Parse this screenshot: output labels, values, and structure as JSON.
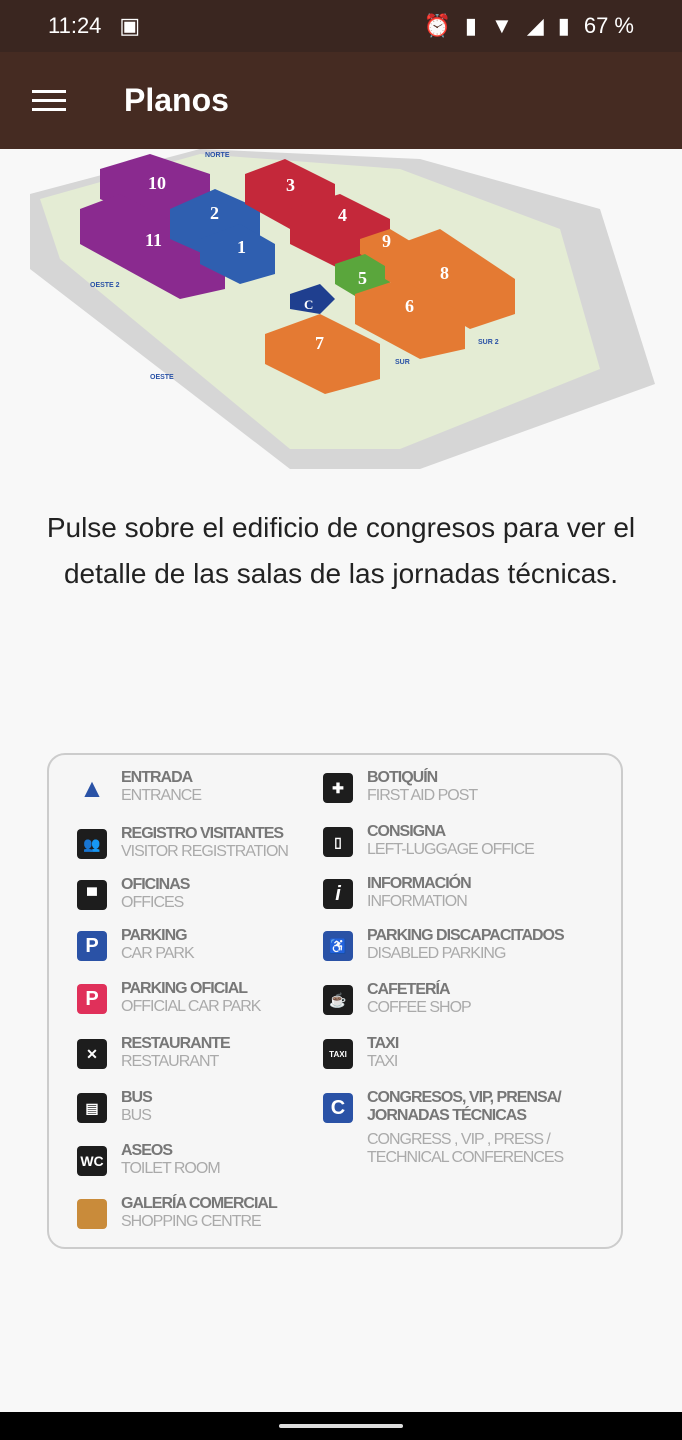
{
  "status": {
    "time": "11:24",
    "battery": "67 %"
  },
  "appbar": {
    "title": "Planos"
  },
  "map": {
    "buildings": [
      "1",
      "2",
      "3",
      "4",
      "5",
      "6",
      "7",
      "8",
      "9",
      "10",
      "11",
      "C"
    ],
    "gates": [
      "NORTE",
      "OESTE 2",
      "OESTE",
      "SUR",
      "SUR 2"
    ]
  },
  "instructions": "Pulse sobre el edificio de congresos para ver el detalle de las salas de las jornadas técnicas.",
  "legend": {
    "left": [
      {
        "es": "ENTRADA",
        "en": "ENTRANCE",
        "icon": "triangle-icon"
      },
      {
        "es": "REGISTRO VISITANTES",
        "en": "VISITOR REGISTRATION",
        "icon": "people-icon"
      },
      {
        "es": "OFICINAS",
        "en": "OFFICES",
        "icon": "desk-icon"
      },
      {
        "es": "PARKING",
        "en": "CAR PARK",
        "icon": "P"
      },
      {
        "es": "PARKING OFICIAL",
        "en": "OFFICIAL CAR PARK",
        "icon": "P"
      },
      {
        "es": "RESTAURANTE",
        "en": "RESTAURANT",
        "icon": "✕"
      },
      {
        "es": "BUS",
        "en": "BUS",
        "icon": "bus-icon"
      },
      {
        "es": "ASEOS",
        "en": "TOILET ROOM",
        "icon": "WC"
      },
      {
        "es": "GALERÍA COMERCIAL",
        "en": "SHOPPING CENTRE",
        "icon": "square"
      }
    ],
    "right": [
      {
        "es": "BOTIQUÍN",
        "en": "FIRST AID POST",
        "icon": "✚"
      },
      {
        "es": "CONSIGNA",
        "en": "LEFT-LUGGAGE OFFICE",
        "icon": "🔒"
      },
      {
        "es": "INFORMACIÓN",
        "en": "INFORMATION",
        "icon": "i"
      },
      {
        "es": "PARKING DISCAPACITADOS",
        "en": "DISABLED PARKING",
        "icon": "♿"
      },
      {
        "es": "CAFETERÍA",
        "en": "COFFEE SHOP",
        "icon": "☕"
      },
      {
        "es": "TAXI",
        "en": "TAXI",
        "icon": "TAXI"
      },
      {
        "es": "CONGRESOS, VIP, PRENSA/ JORNADAS TÉCNICAS",
        "en": "CONGRESS , VIP , PRESS / TECHNICAL CONFERENCES",
        "icon": "C"
      }
    ]
  },
  "colors": {
    "statusbar": "#3a2620",
    "appbar": "#452b22",
    "parking": "#2a52a6",
    "official_parking": "#e0305a",
    "shopping": "#c98b3a"
  }
}
